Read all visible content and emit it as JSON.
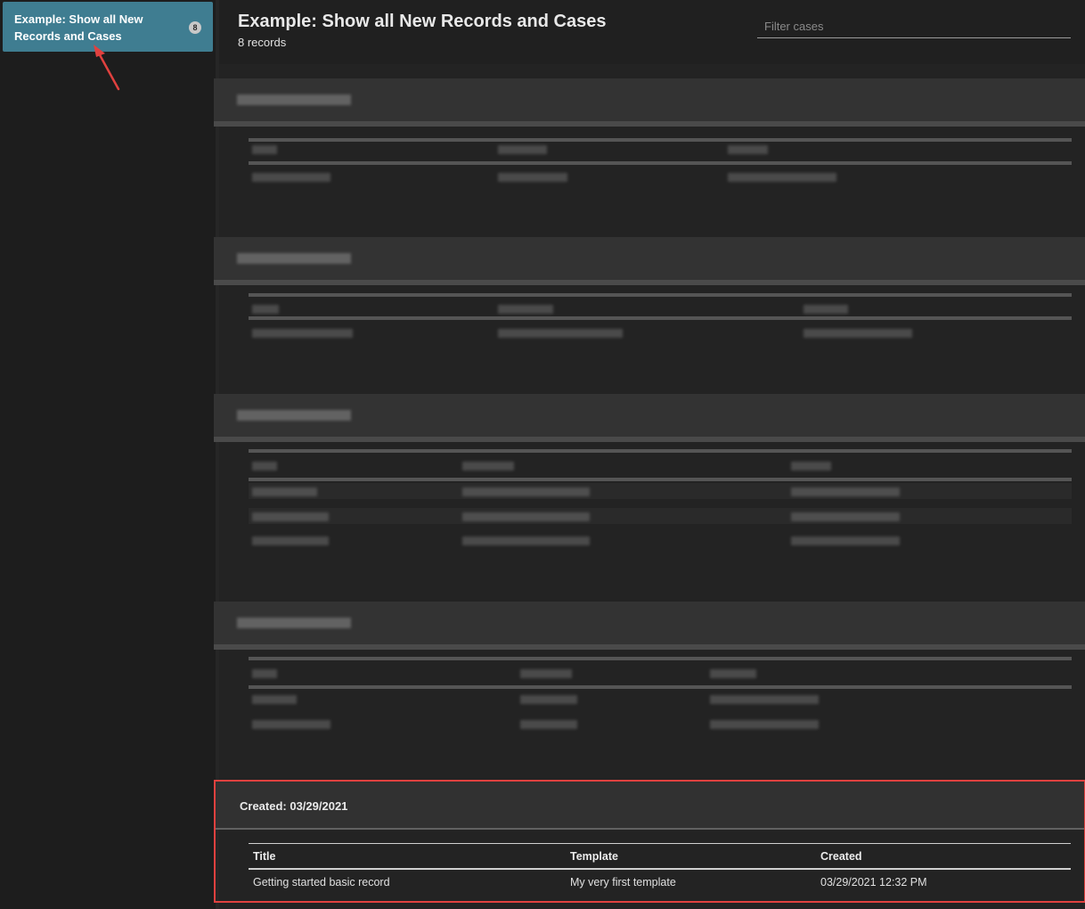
{
  "sidebar": {
    "view": {
      "label": "Example: Show all New Records and Cases",
      "count": "8"
    }
  },
  "header": {
    "title": "Example: Show all New Records and Cases",
    "record_count": "8 records",
    "filter_placeholder": "Filter cases"
  },
  "colors": {
    "accent": "#3f7d91",
    "highlight": "#e0413f",
    "annotation_arrow": "#e0413f"
  },
  "group": {
    "title": "Created: 03/29/2021",
    "columns": [
      "Title",
      "Template",
      "Created"
    ],
    "rows": [
      {
        "title": "Getting started basic record",
        "template": "My very first template",
        "created": "03/29/2021 12:32 PM"
      }
    ]
  }
}
